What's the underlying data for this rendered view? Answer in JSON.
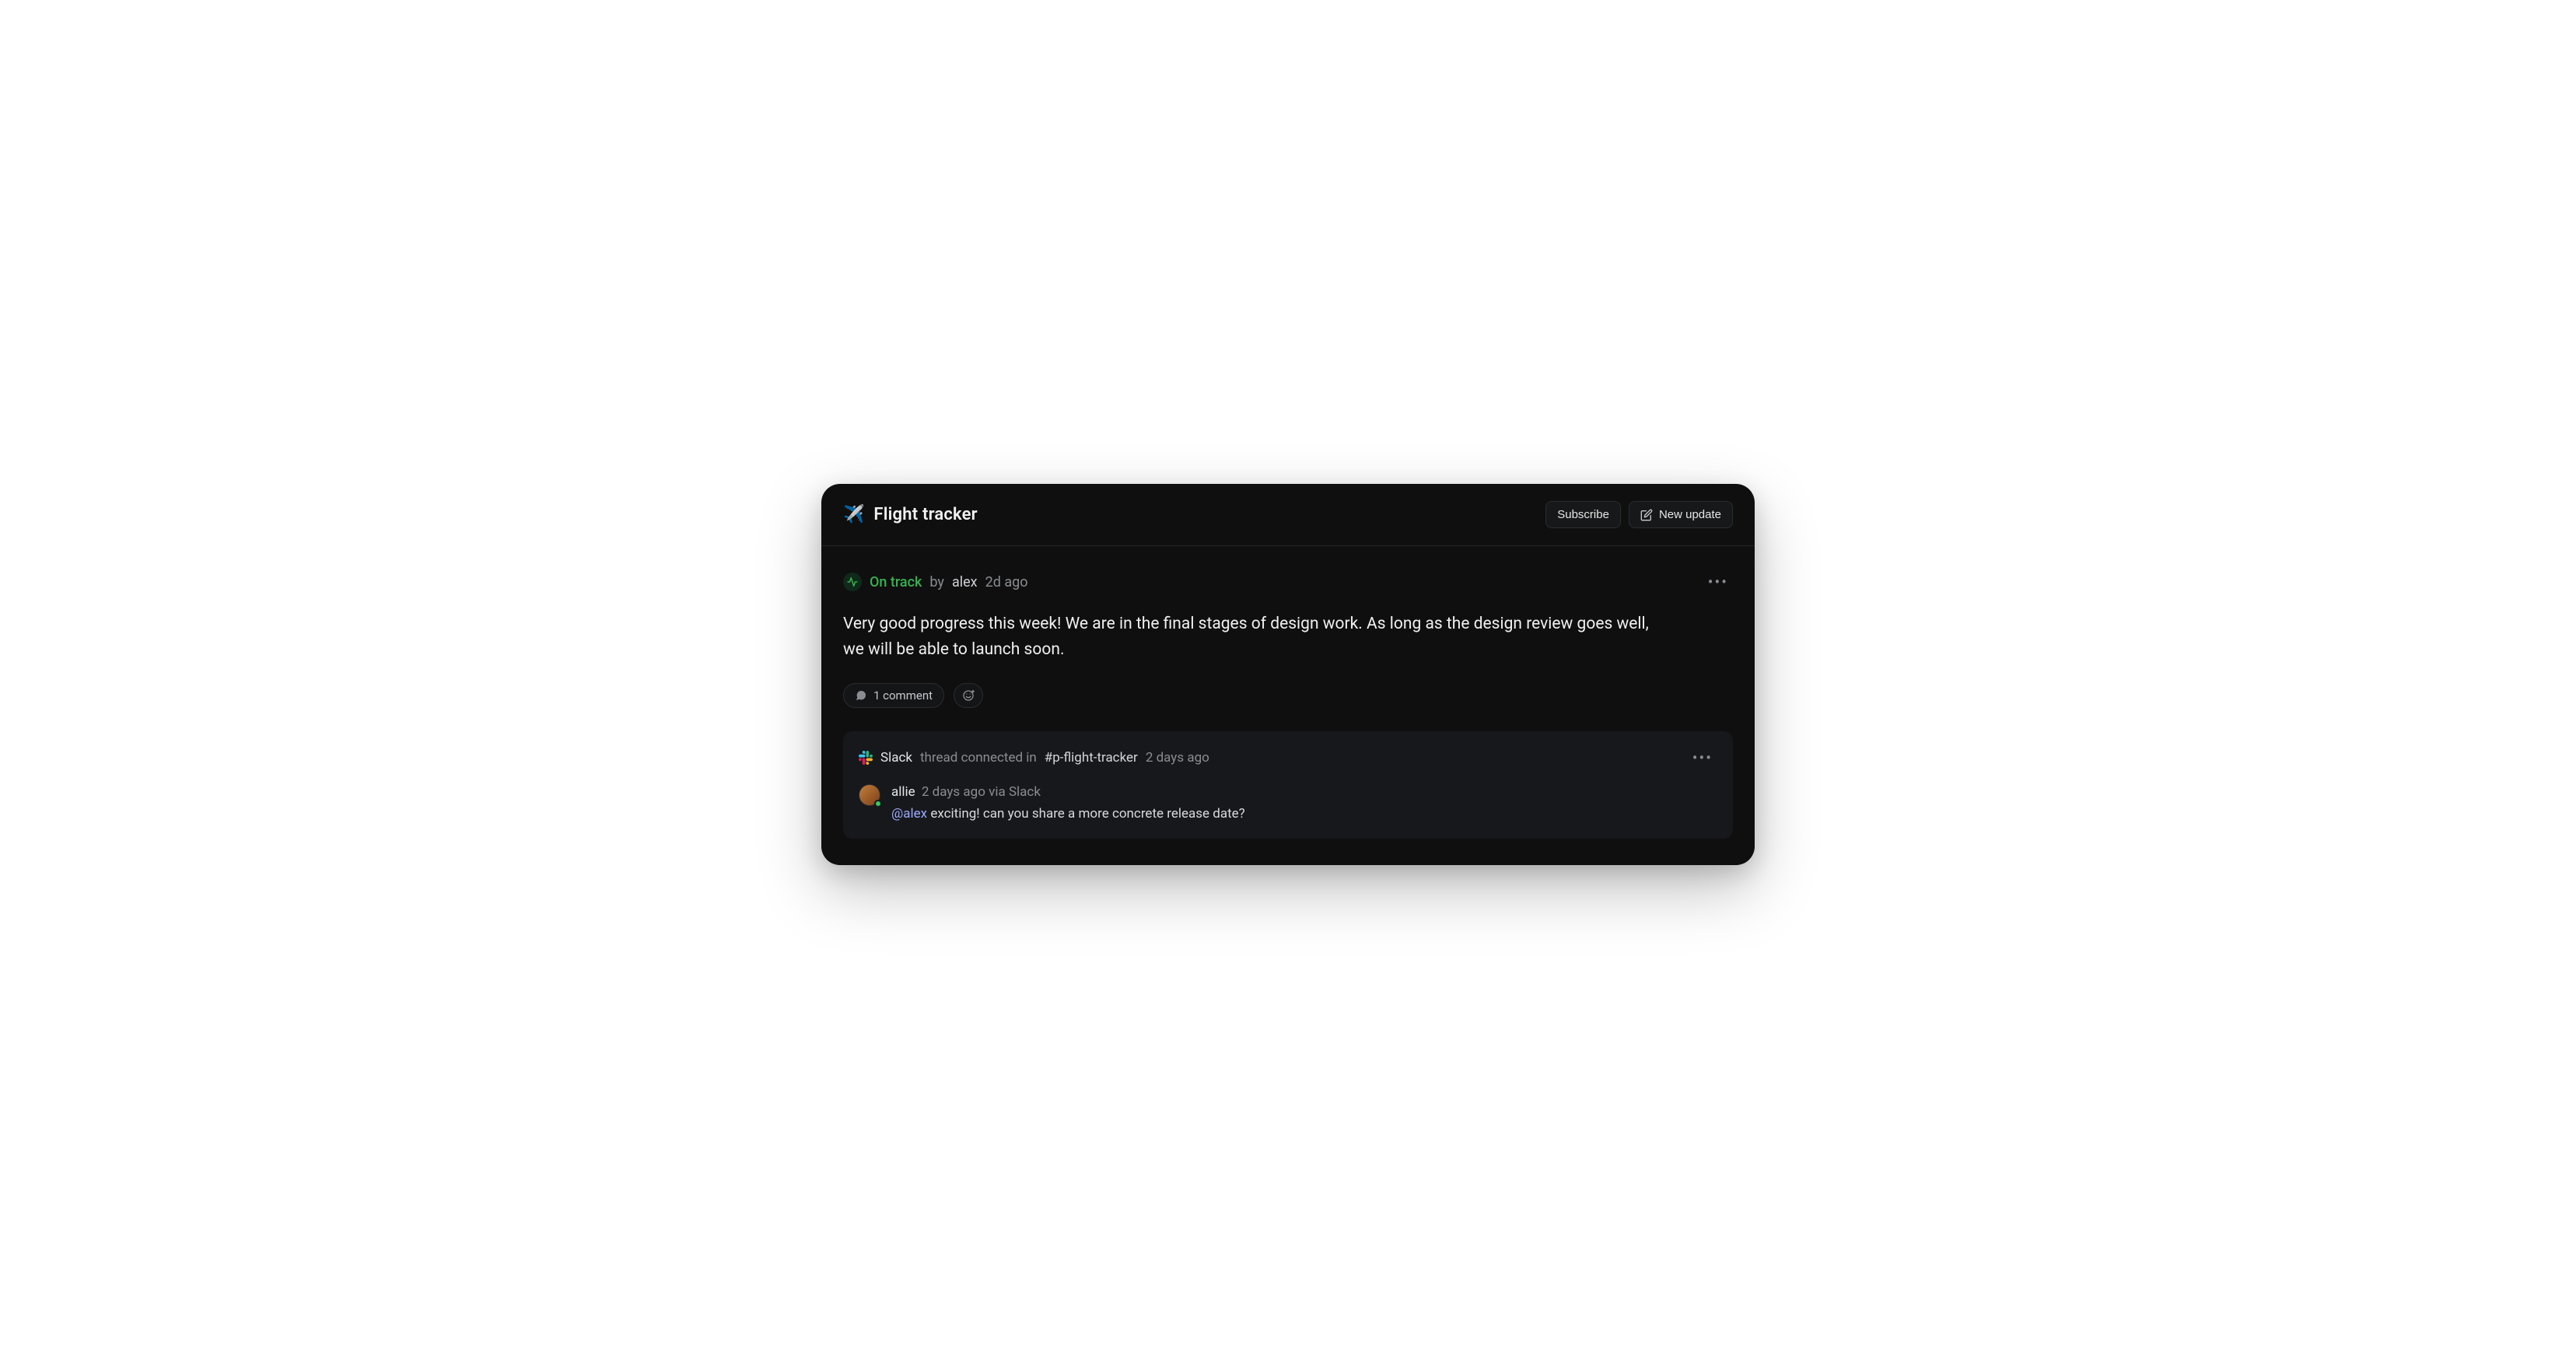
{
  "header": {
    "icon": "✈️",
    "title": "Flight tracker",
    "subscribe_label": "Subscribe",
    "new_update_label": "New update"
  },
  "update": {
    "status_label": "On track",
    "by_label": "by",
    "author": "alex",
    "time": "2d ago",
    "body": "Very good progress this week!  We are in the final stages of design work. As long as the design review goes well, we will be able to launch soon.",
    "comments_label": "1 comment"
  },
  "thread": {
    "source": "Slack",
    "connected_label": "thread connected in",
    "channel": "#p-flight-tracker",
    "time": "2 days ago",
    "comment": {
      "author": "allie",
      "time": "2 days ago",
      "via_label": "via Slack",
      "mention": "@alex",
      "text": "exciting! can you share a more concrete release date?"
    }
  }
}
